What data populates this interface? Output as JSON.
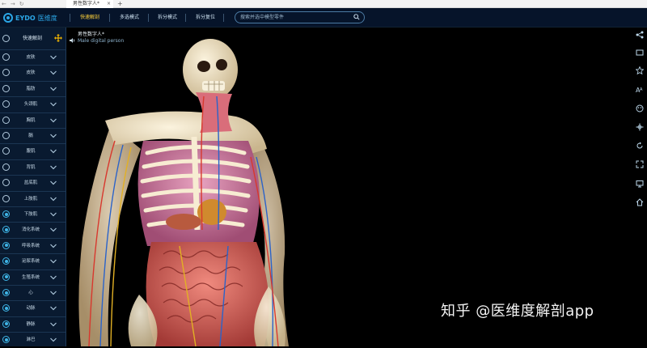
{
  "browser": {
    "tab_title": "男性数字人*",
    "tab_close": "×",
    "new_tab": "+",
    "nav": "←→↻"
  },
  "app": {
    "logo_text": "EYDO",
    "logo_cn": "医维度",
    "menu": [
      "快速解剖",
      "多选模式",
      "拆分模式",
      "拆分复位"
    ],
    "active_menu_index": 0,
    "search_placeholder": "搜索并选中模型零件"
  },
  "sidebar": {
    "header_label": "快速解剖",
    "items": [
      {
        "label": "皮肤",
        "on": false
      },
      {
        "label": "皮肤",
        "on": false
      },
      {
        "label": "脂肪",
        "on": false
      },
      {
        "label": "头颈肌",
        "on": false
      },
      {
        "label": "胸肌",
        "on": false
      },
      {
        "label": "膈",
        "on": false
      },
      {
        "label": "腹肌",
        "on": false
      },
      {
        "label": "背肌",
        "on": false
      },
      {
        "label": "盆底肌",
        "on": false
      },
      {
        "label": "上肢肌",
        "on": false
      },
      {
        "label": "下肢肌",
        "on": true
      },
      {
        "label": "消化系统",
        "on": true
      },
      {
        "label": "呼吸系统",
        "on": true
      },
      {
        "label": "泌尿系统",
        "on": true
      },
      {
        "label": "生殖系统",
        "on": true
      },
      {
        "label": "心",
        "on": true
      },
      {
        "label": "动脉",
        "on": true
      },
      {
        "label": "静脉",
        "on": true
      },
      {
        "label": "淋巴",
        "on": true
      }
    ]
  },
  "viewport": {
    "model_title": "男性数字人*",
    "model_subtitle": "Male digital person"
  },
  "right_toolbar": [
    "share-icon",
    "screen-icon",
    "star-icon",
    "text-size-icon",
    "palette-icon",
    "move-icon",
    "rotate-icon",
    "fullscreen-icon",
    "monitor-icon",
    "home-icon"
  ],
  "watermark": "知乎 @医维度解剖app",
  "colors": {
    "accent": "#2ba6e6",
    "active_menu": "#ffd23a",
    "appbar": "#06142a",
    "sidebar": "#091a30"
  }
}
